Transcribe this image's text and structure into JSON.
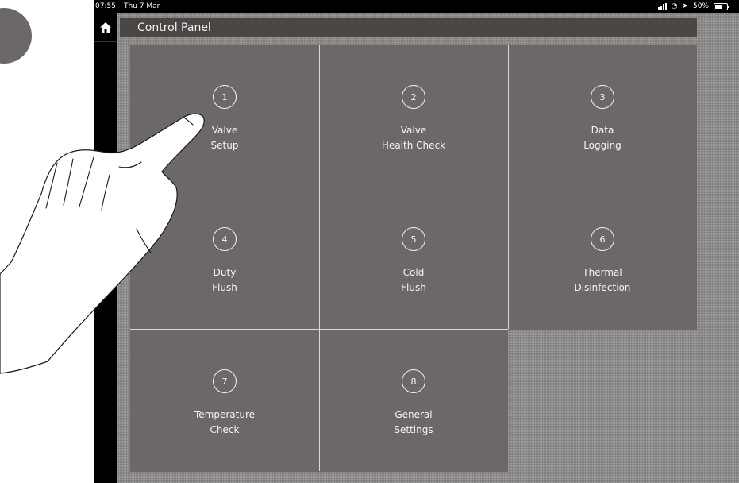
{
  "status_bar": {
    "time": "07:55",
    "date": "Thu 7 Mar",
    "battery": "50%",
    "icons": [
      "signal-icon",
      "wifi-icon",
      "location-icon",
      "battery-icon"
    ]
  },
  "sidebar": {
    "home_icon": "home-icon"
  },
  "header": {
    "title": "Control Panel"
  },
  "tiles": [
    {
      "number": "1",
      "line1": "Valve",
      "line2": "Setup"
    },
    {
      "number": "2",
      "line1": "Valve",
      "line2": "Health Check"
    },
    {
      "number": "3",
      "line1": "Data",
      "line2": "Logging"
    },
    {
      "number": "4",
      "line1": "Duty",
      "line2": "Flush"
    },
    {
      "number": "5",
      "line1": "Cold",
      "line2": "Flush"
    },
    {
      "number": "6",
      "line1": "Thermal",
      "line2": "Disinfection"
    },
    {
      "number": "7",
      "line1": "Temperature",
      "line2": "Check"
    },
    {
      "number": "8",
      "line1": "General",
      "line2": "Settings"
    }
  ],
  "colors": {
    "tile": "#6d6868",
    "title_bar": "#4a4644",
    "background": "#8f8d8c",
    "divider": "#d9d9d9"
  }
}
